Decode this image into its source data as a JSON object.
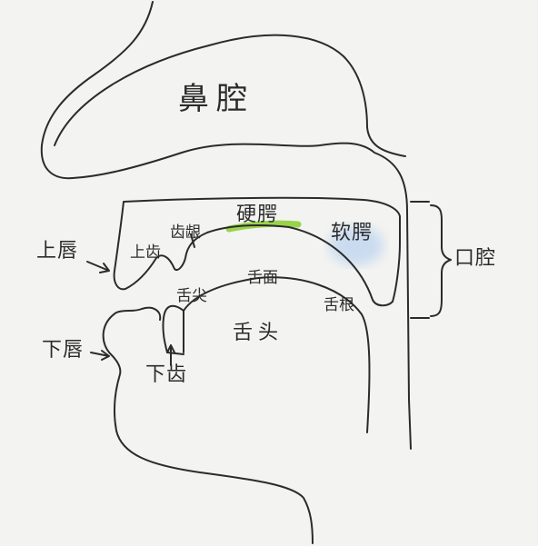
{
  "labels": {
    "nasal_cavity": "鼻腔",
    "oral_cavity": "口腔",
    "upper_lip": "上唇",
    "lower_lip": "下唇",
    "upper_teeth": "上齿",
    "lower_teeth": "下齿",
    "alveolar_ridge": "齿龈",
    "hard_palate": "硬腭",
    "soft_palate": "软腭",
    "tongue": "舌头",
    "tongue_tip": "舌尖",
    "tongue_blade": "舌面",
    "tongue_root": "舌根"
  },
  "highlight_colors": {
    "hard_palate": "#8fcf3a",
    "soft_palate": "#a9c9ee"
  },
  "ink_color": "#2b2b2b"
}
